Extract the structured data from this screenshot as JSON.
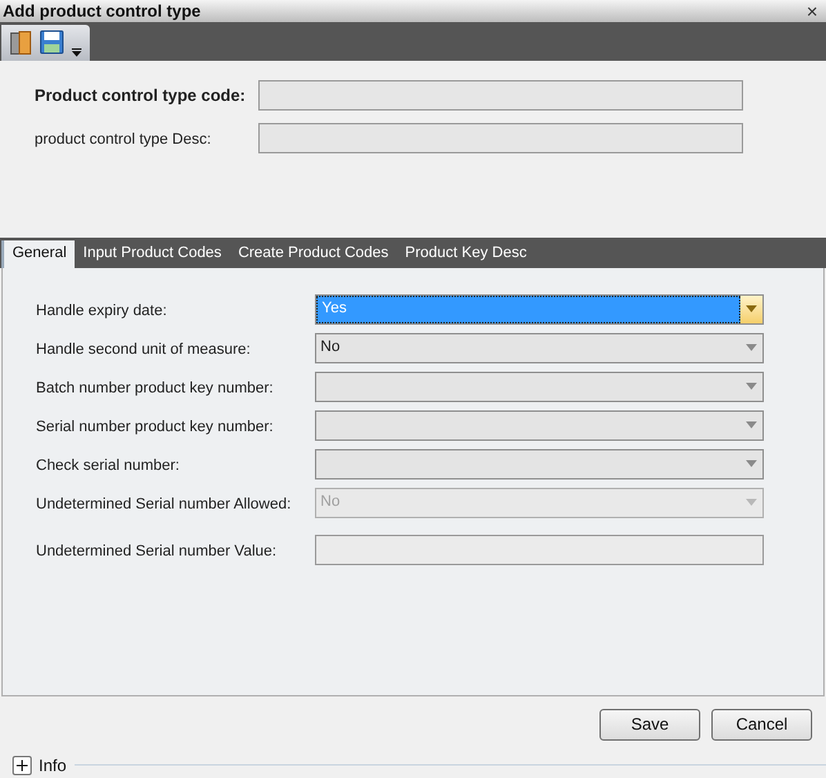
{
  "window": {
    "title": "Add product control type",
    "close": "×"
  },
  "header_fields": [
    {
      "label": "Product control type code:",
      "bold": true
    },
    {
      "label": "product control type Desc:",
      "bold": false
    }
  ],
  "tabs": [
    {
      "label": "General",
      "selected": true
    },
    {
      "label": "Input Product Codes",
      "selected": false
    },
    {
      "label": "Create Product Codes",
      "selected": false
    },
    {
      "label": "Product Key Desc",
      "selected": false
    }
  ],
  "fields": [
    {
      "kind": "select",
      "label": "Handle expiry date:",
      "value": "Yes",
      "focused": true,
      "disabled": false
    },
    {
      "kind": "select",
      "label": "Handle second unit of measure:",
      "value": "No",
      "focused": false,
      "disabled": false
    },
    {
      "kind": "select",
      "label": "Batch number product key number:",
      "focused": false,
      "disabled": false
    },
    {
      "kind": "select",
      "label": "Serial number product key number:",
      "focused": false,
      "disabled": false
    },
    {
      "kind": "select",
      "label": "Check serial number:",
      "focused": false,
      "disabled": false
    },
    {
      "kind": "select",
      "label": "Undetermined Serial number Allowed:",
      "value": "No",
      "focused": false,
      "disabled": true
    },
    {
      "kind": "text",
      "label": "Undetermined Serial number Value:"
    }
  ],
  "buttons": [
    "Save",
    "Cancel"
  ],
  "info": {
    "label": "Info",
    "expanded": false
  }
}
